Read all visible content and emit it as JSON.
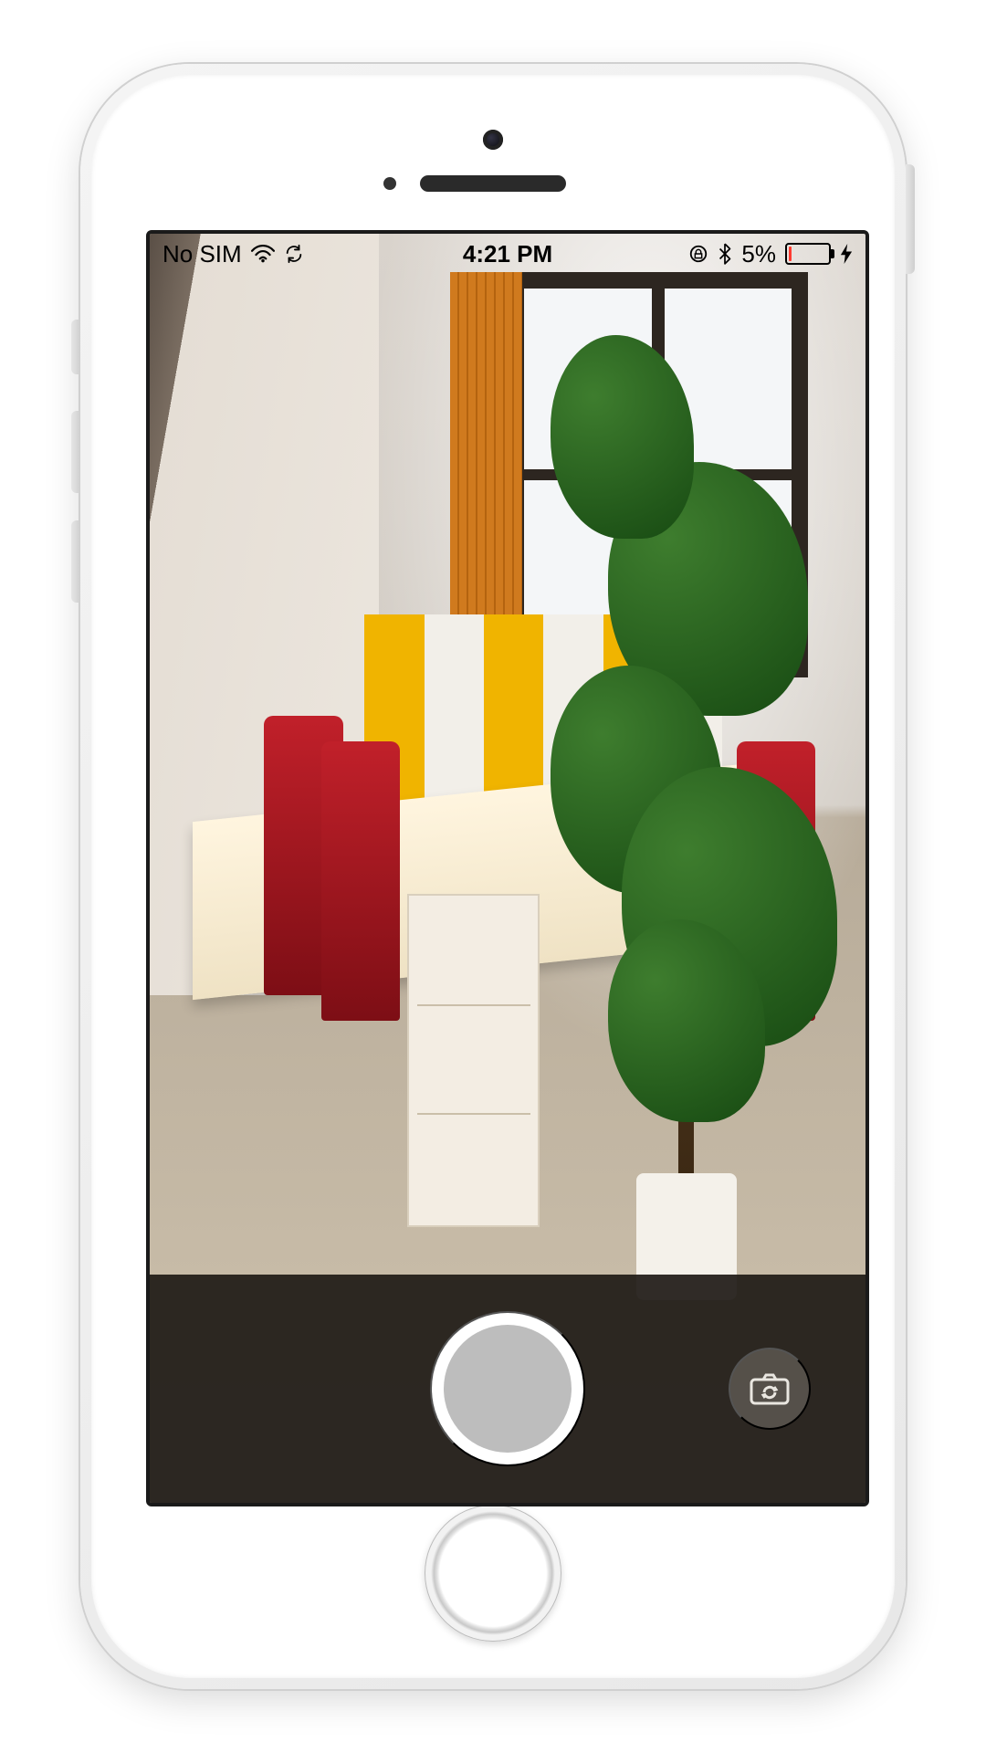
{
  "status_bar": {
    "carrier": "No SIM",
    "wifi_icon": "wifi-icon",
    "sync_icon": "sync-icon",
    "time": "4:21 PM",
    "orientation_lock_icon": "orientation-lock-icon",
    "bluetooth_icon": "bluetooth-icon",
    "battery_percent": "5%",
    "battery_level_pct": 5,
    "battery_color": "#ff3b30",
    "charging_icon": "bolt-icon"
  },
  "camera": {
    "shutter_label": "Shutter",
    "flip_label": "Switch Camera",
    "viewfinder_description": "Office interior: cubicle desks with yellow/white dividers, red office chairs, filing cabinet, large potted plant, window with building exterior, beige tile floor."
  }
}
